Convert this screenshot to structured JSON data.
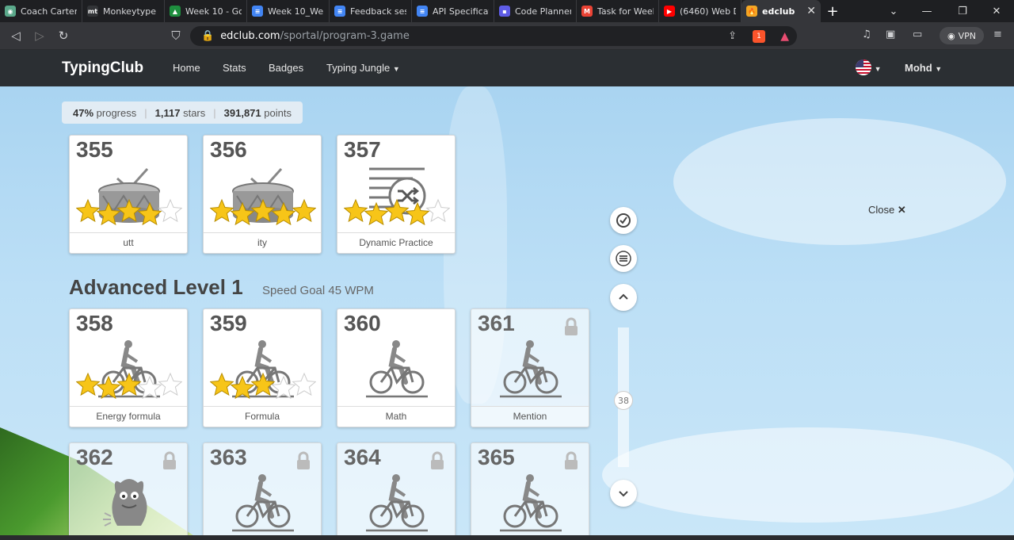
{
  "browser": {
    "tabs": [
      {
        "title": "Coach Carter",
        "color": "#5aa88a",
        "glyph": "◉"
      },
      {
        "title": "Monkeytype",
        "color": "#323437",
        "glyph": "mt"
      },
      {
        "title": "Week 10 - Go",
        "color": "#1e8e3e",
        "glyph": "▲"
      },
      {
        "title": "Week 10_Web",
        "color": "#4285f4",
        "glyph": "≡"
      },
      {
        "title": "Feedback ses",
        "color": "#4285f4",
        "glyph": "≡"
      },
      {
        "title": "API Specificat",
        "color": "#4285f4",
        "glyph": "≡"
      },
      {
        "title": "Code Planner",
        "color": "#5e5ce6",
        "glyph": "▪"
      },
      {
        "title": "Task for Week",
        "color": "#ea4335",
        "glyph": "M"
      },
      {
        "title": "(6460) Web D",
        "color": "#ff0000",
        "glyph": "▶"
      }
    ],
    "active_tab": {
      "title": "edclub",
      "close": "✕"
    },
    "new_tab": "+",
    "url_host": "edclub.com",
    "url_path": "/sportal/program-3.game",
    "vpn_label": "VPN",
    "brave_count": "1"
  },
  "site": {
    "logo": "TypingClub",
    "nav": [
      "Home",
      "Stats",
      "Badges",
      "Typing Jungle"
    ],
    "user": "Mohd"
  },
  "progress": {
    "percent": "47%",
    "percent_label": "progress",
    "stars": "1,117",
    "stars_label": "stars",
    "points": "391,871",
    "points_label": "points"
  },
  "section": {
    "title": "Advanced Level 1",
    "subtitle": "Speed Goal 45 WPM"
  },
  "lessons": [
    {
      "num": "355",
      "label": "utt",
      "icon": "drum-icon",
      "stars": 4,
      "locked": false
    },
    {
      "num": "356",
      "label": "ity",
      "icon": "drum-icon",
      "stars": 5,
      "locked": false
    },
    {
      "num": "357",
      "label": "Dynamic Practice",
      "icon": "shuffle-icon",
      "stars": 4,
      "locked": false
    },
    {
      "num": "358",
      "label": "Energy formula",
      "icon": "bicycle-icon",
      "stars": 3,
      "locked": false
    },
    {
      "num": "359",
      "label": "Formula",
      "icon": "bicycle-icon",
      "stars": 3,
      "locked": false
    },
    {
      "num": "360",
      "label": "Math",
      "icon": "bicycle-icon",
      "stars": 0,
      "locked": false
    },
    {
      "num": "361",
      "label": "Mention",
      "icon": "bicycle-icon",
      "stars": 0,
      "locked": true
    },
    {
      "num": "362",
      "label": "",
      "icon": "monster-icon",
      "stars": 0,
      "locked": true
    },
    {
      "num": "363",
      "label": "",
      "icon": "bicycle-icon",
      "stars": 0,
      "locked": true
    },
    {
      "num": "364",
      "label": "",
      "icon": "bicycle-icon",
      "stars": 0,
      "locked": true
    },
    {
      "num": "365",
      "label": "",
      "icon": "bicycle-icon",
      "stars": 0,
      "locked": true
    }
  ],
  "side_controls": {
    "page_number": "38"
  },
  "close_label": "Close",
  "colors": {
    "star_gold": "#f7c518",
    "star_empty": "#ffffff",
    "nav_bg": "#2b2f33",
    "sky": "#b5dbf4"
  }
}
